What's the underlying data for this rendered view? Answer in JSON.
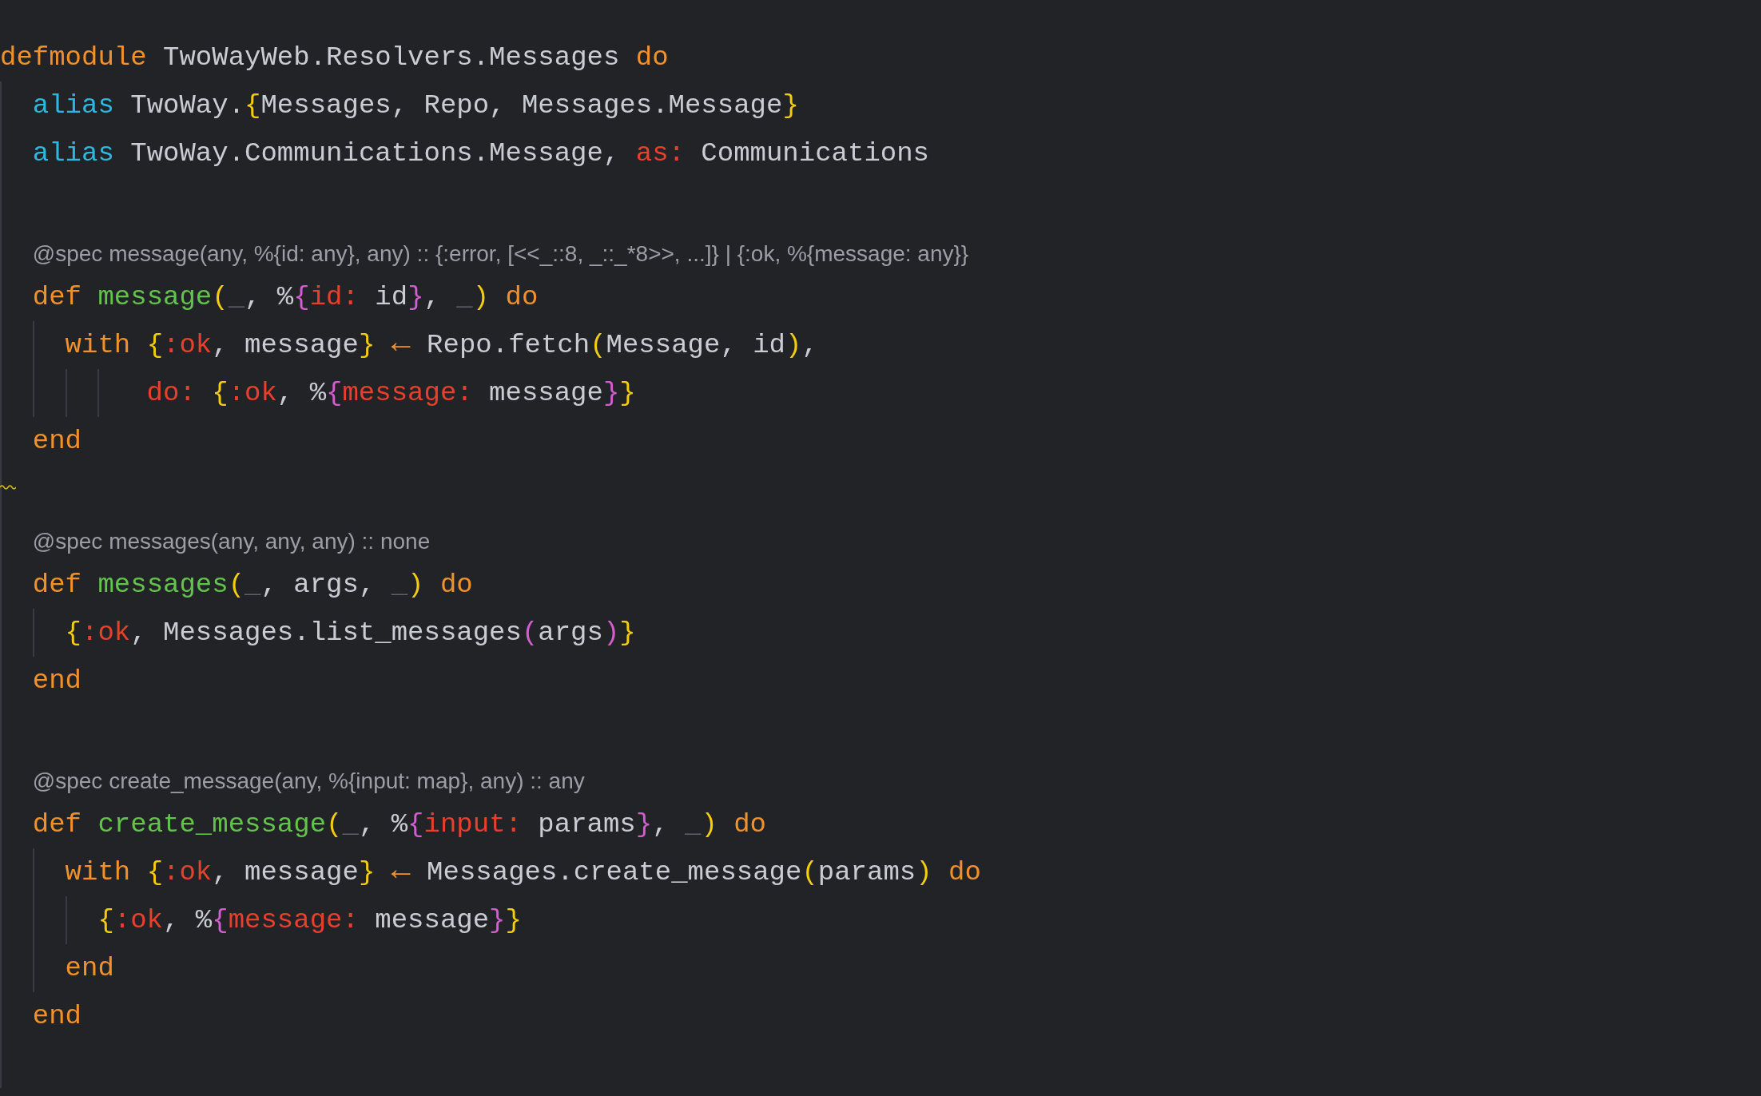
{
  "editor": {
    "lines": [
      {
        "kind": "code",
        "tokens": [
          {
            "kind": "keyword",
            "text": "defmodule"
          },
          {
            "kind": "plain",
            "text": " TwoWayWeb.Resolvers.Messages "
          },
          {
            "kind": "keyword",
            "text": "do"
          }
        ],
        "children": [
          {
            "kind": "code",
            "tokens": [
              {
                "kind": "directive",
                "text": "alias"
              },
              {
                "kind": "plain",
                "text": " TwoWay."
              },
              {
                "kind": "brace",
                "text": "{"
              },
              {
                "kind": "plain",
                "text": "Messages, Repo, Messages.Message"
              },
              {
                "kind": "brace",
                "text": "}"
              }
            ]
          },
          {
            "kind": "code",
            "tokens": [
              {
                "kind": "directive",
                "text": "alias"
              },
              {
                "kind": "plain",
                "text": " TwoWay.Communications.Message, "
              },
              {
                "kind": "atom",
                "text": "as:"
              },
              {
                "kind": "plain",
                "text": " Communications"
              }
            ]
          },
          {
            "kind": "blank",
            "warning": false
          },
          {
            "kind": "spec",
            "text": "@spec message(any, %{id: any}, any) :: {:error, [<<_::8, _::_*8>>, ...]} | {:ok, %{message: any}}"
          },
          {
            "kind": "code",
            "tokens": [
              {
                "kind": "keyword",
                "text": "def "
              },
              {
                "kind": "function",
                "text": "message"
              },
              {
                "kind": "brace",
                "text": "("
              },
              {
                "kind": "unused",
                "text": "_"
              },
              {
                "kind": "plain",
                "text": ", %"
              },
              {
                "kind": "map",
                "text": "{"
              },
              {
                "kind": "atom",
                "text": "id:"
              },
              {
                "kind": "plain",
                "text": " id"
              },
              {
                "kind": "map",
                "text": "}"
              },
              {
                "kind": "plain",
                "text": ", "
              },
              {
                "kind": "unused",
                "text": "_"
              },
              {
                "kind": "brace",
                "text": ") "
              },
              {
                "kind": "keyword",
                "text": "do"
              }
            ],
            "children": [
              {
                "kind": "code",
                "tokens": [
                  {
                    "kind": "keyword",
                    "text": "with "
                  },
                  {
                    "kind": "brace",
                    "text": "{"
                  },
                  {
                    "kind": "atom",
                    "text": ":ok"
                  },
                  {
                    "kind": "plain",
                    "text": ", message"
                  },
                  {
                    "kind": "brace",
                    "text": "} "
                  },
                  {
                    "kind": "arrow",
                    "text": "←"
                  },
                  {
                    "kind": "plain",
                    "text": " Repo.fetch"
                  },
                  {
                    "kind": "brace",
                    "text": "("
                  },
                  {
                    "kind": "plain",
                    "text": "Message, id"
                  },
                  {
                    "kind": "brace",
                    "text": ")"
                  },
                  {
                    "kind": "plain",
                    "text": ","
                  }
                ],
                "children": [
                  {
                    "kind": "group",
                    "children": [
                      {
                        "kind": "code",
                        "tokens": [
                          {
                            "kind": "atom",
                            "text": " do: "
                          },
                          {
                            "kind": "brace",
                            "text": "{"
                          },
                          {
                            "kind": "atom",
                            "text": ":ok"
                          },
                          {
                            "kind": "plain",
                            "text": ", %"
                          },
                          {
                            "kind": "map",
                            "text": "{"
                          },
                          {
                            "kind": "atom",
                            "text": "message:"
                          },
                          {
                            "kind": "plain",
                            "text": " message"
                          },
                          {
                            "kind": "map",
                            "text": "}"
                          },
                          {
                            "kind": "brace",
                            "text": "}"
                          }
                        ]
                      }
                    ]
                  }
                ]
              }
            ]
          },
          {
            "kind": "code",
            "tokens": [
              {
                "kind": "keyword",
                "text": "end"
              }
            ]
          },
          {
            "kind": "blank",
            "warning": true
          },
          {
            "kind": "spec",
            "text": "@spec messages(any, any, any) :: none"
          },
          {
            "kind": "code",
            "tokens": [
              {
                "kind": "keyword",
                "text": "def "
              },
              {
                "kind": "function",
                "text": "messages"
              },
              {
                "kind": "brace",
                "text": "("
              },
              {
                "kind": "unused",
                "text": "_"
              },
              {
                "kind": "plain",
                "text": ", args, "
              },
              {
                "kind": "unused",
                "text": "_"
              },
              {
                "kind": "brace",
                "text": ") "
              },
              {
                "kind": "keyword",
                "text": "do"
              }
            ],
            "children": [
              {
                "kind": "code",
                "tokens": [
                  {
                    "kind": "brace",
                    "text": "{"
                  },
                  {
                    "kind": "atom",
                    "text": ":ok"
                  },
                  {
                    "kind": "plain",
                    "text": ", Messages.list_messages"
                  },
                  {
                    "kind": "map",
                    "text": "("
                  },
                  {
                    "kind": "plain",
                    "text": "args"
                  },
                  {
                    "kind": "map",
                    "text": ")"
                  },
                  {
                    "kind": "brace",
                    "text": "}"
                  }
                ]
              }
            ]
          },
          {
            "kind": "code",
            "tokens": [
              {
                "kind": "keyword",
                "text": "end"
              }
            ]
          },
          {
            "kind": "blank",
            "warning": false
          },
          {
            "kind": "spec",
            "text": "@spec create_message(any, %{input: map}, any) :: any"
          },
          {
            "kind": "code",
            "tokens": [
              {
                "kind": "keyword",
                "text": "def "
              },
              {
                "kind": "function",
                "text": "create_message"
              },
              {
                "kind": "brace",
                "text": "("
              },
              {
                "kind": "unused",
                "text": "_"
              },
              {
                "kind": "plain",
                "text": ", %"
              },
              {
                "kind": "map",
                "text": "{"
              },
              {
                "kind": "atom",
                "text": "input:"
              },
              {
                "kind": "plain",
                "text": " params"
              },
              {
                "kind": "map",
                "text": "}"
              },
              {
                "kind": "plain",
                "text": ", "
              },
              {
                "kind": "unused",
                "text": "_"
              },
              {
                "kind": "brace",
                "text": ") "
              },
              {
                "kind": "keyword",
                "text": "do"
              }
            ],
            "children": [
              {
                "kind": "code",
                "tokens": [
                  {
                    "kind": "keyword",
                    "text": "with "
                  },
                  {
                    "kind": "brace",
                    "text": "{"
                  },
                  {
                    "kind": "atom",
                    "text": ":ok"
                  },
                  {
                    "kind": "plain",
                    "text": ", message"
                  },
                  {
                    "kind": "brace",
                    "text": "} "
                  },
                  {
                    "kind": "arrow",
                    "text": "←"
                  },
                  {
                    "kind": "plain",
                    "text": " Messages.create_message"
                  },
                  {
                    "kind": "brace",
                    "text": "("
                  },
                  {
                    "kind": "plain",
                    "text": "params"
                  },
                  {
                    "kind": "brace",
                    "text": ") "
                  },
                  {
                    "kind": "keyword",
                    "text": "do"
                  }
                ],
                "children": [
                  {
                    "kind": "code",
                    "tokens": [
                      {
                        "kind": "brace",
                        "text": "{"
                      },
                      {
                        "kind": "atom",
                        "text": ":ok"
                      },
                      {
                        "kind": "plain",
                        "text": ", %"
                      },
                      {
                        "kind": "map",
                        "text": "{"
                      },
                      {
                        "kind": "atom",
                        "text": "message:"
                      },
                      {
                        "kind": "plain",
                        "text": " message"
                      },
                      {
                        "kind": "map",
                        "text": "}"
                      },
                      {
                        "kind": "brace",
                        "text": "}"
                      }
                    ]
                  }
                ]
              },
              {
                "kind": "code",
                "tokens": [
                  {
                    "kind": "keyword",
                    "text": "end"
                  }
                ]
              }
            ]
          },
          {
            "kind": "code",
            "tokens": [
              {
                "kind": "keyword",
                "text": "end"
              }
            ]
          },
          {
            "kind": "blank",
            "warning": false
          }
        ]
      }
    ]
  }
}
